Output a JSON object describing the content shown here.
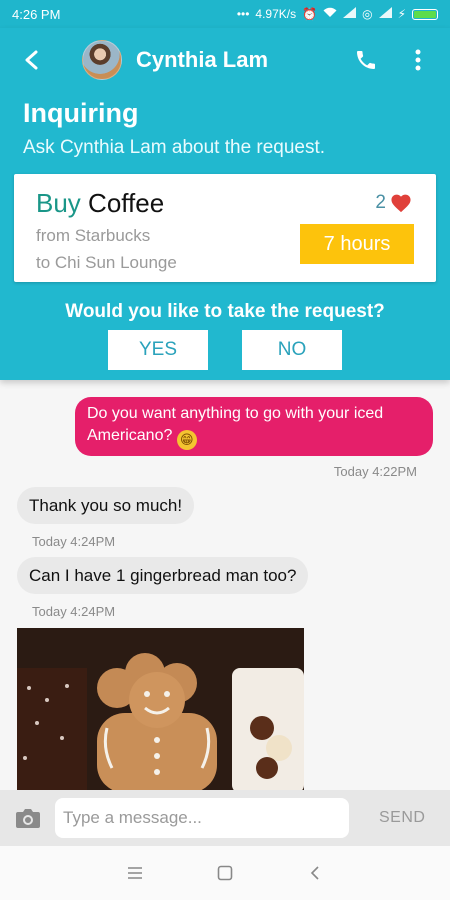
{
  "status_bar": {
    "time": "4:26 PM",
    "network_speed": "4.97K/s",
    "battery_level": 1.0,
    "battery_color": "#5ddc4b"
  },
  "app_bar": {
    "contact_name": "Cynthia Lam",
    "back_icon": "arrow-back-icon",
    "phone_icon": "phone-icon",
    "more_icon": "more-vert-icon"
  },
  "request": {
    "status_title": "Inquiring",
    "status_subtitle": "Ask Cynthia Lam about the request.",
    "verb": "Buy",
    "item": "Coffee",
    "from": "from Starbucks",
    "to": "to Chi Sun Lounge",
    "likes": "2",
    "time_left": "7 hours",
    "question": "Would you like to take the request?",
    "yes_label": "YES",
    "no_label": "NO"
  },
  "messages": [
    {
      "direction": "out",
      "text": "Do you want anything to go with your iced Americano?",
      "emoji": "grin-emoji",
      "time": "Today 4:22PM"
    },
    {
      "direction": "in",
      "text": "Thank you so much!",
      "time": "Today 4:24PM"
    },
    {
      "direction": "in",
      "text": "Can I have 1 gingerbread man too?",
      "time": "Today 4:24PM"
    },
    {
      "direction": "in",
      "type": "photo",
      "content": "gingerbread-photo"
    }
  ],
  "composer": {
    "placeholder": "Type a message...",
    "send_label": "SEND",
    "camera_icon": "camera-icon"
  },
  "colors": {
    "header": "#21b8cf",
    "outgoing_bubble": "#e51f6a",
    "incoming_bubble": "#e9e9e9",
    "time_badge": "#fdc30c",
    "verb": "#1a9688",
    "heart": "#e0403a"
  }
}
